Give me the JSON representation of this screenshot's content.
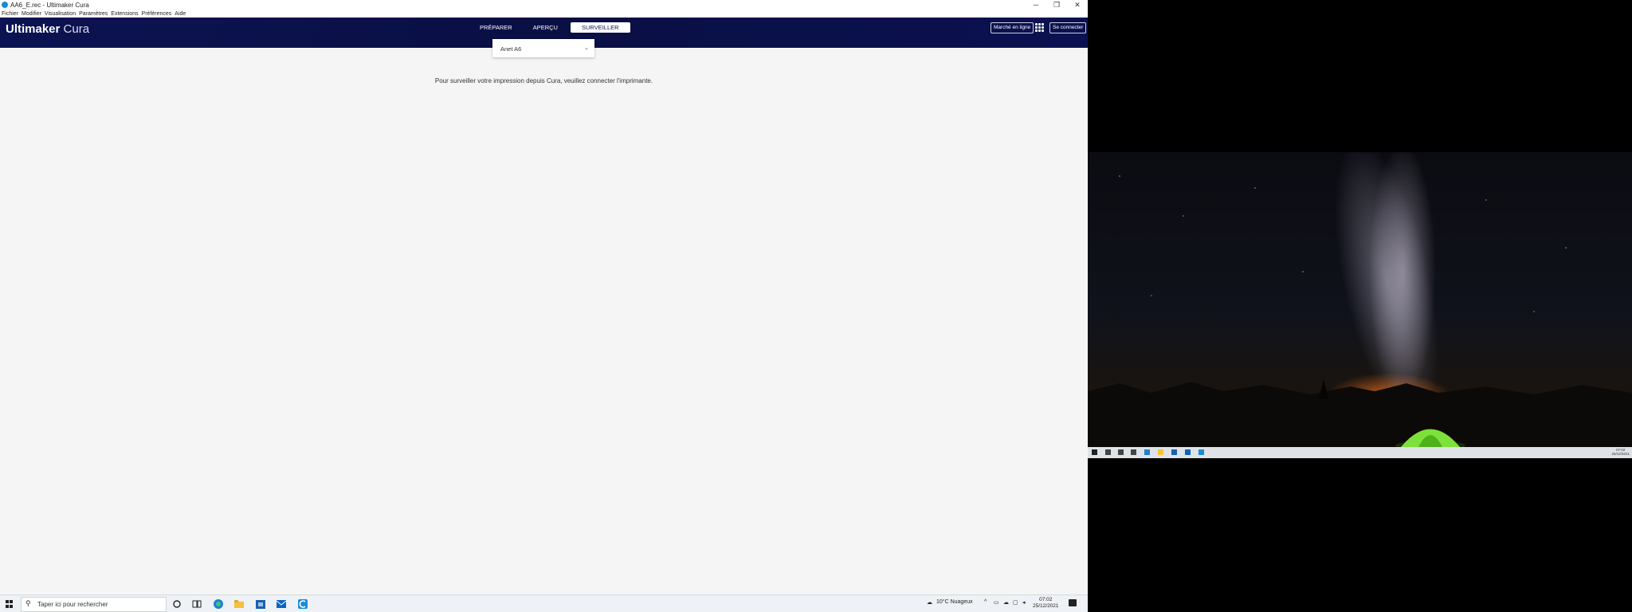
{
  "window": {
    "title": "AA6_E.rec - Ultimaker Cura",
    "controls": [
      "─",
      "❐",
      "✕"
    ]
  },
  "menu": [
    "Fichier",
    "Modifier",
    "Visualisation",
    "Paramètres",
    "Extensions",
    "Préférences",
    "Aide"
  ],
  "header": {
    "logo_bold": "Ultimaker",
    "logo_light": "Cura",
    "stages": [
      "PRÉPARER",
      "APERÇU",
      "SURVEILLER"
    ],
    "active_stage": "SURVEILLER",
    "marketplace_label": "Marché en ligne",
    "signin_label": "Se connecter"
  },
  "printer_selector": {
    "value": "Anet A6",
    "chevron": "⌄"
  },
  "main_message": "Pour surveiller votre impression depuis Cura, veuillez connecter l'imprimante.",
  "taskbar": {
    "search_placeholder": "Taper ici pour rechercher",
    "weather": "10°C  Nuageux",
    "time": "07:02",
    "date": "25/12/2021"
  },
  "colors": {
    "header_bg": "#0c1352",
    "content_bg": "#f5f5f5",
    "taskbar_bg": "#eef1f5"
  }
}
